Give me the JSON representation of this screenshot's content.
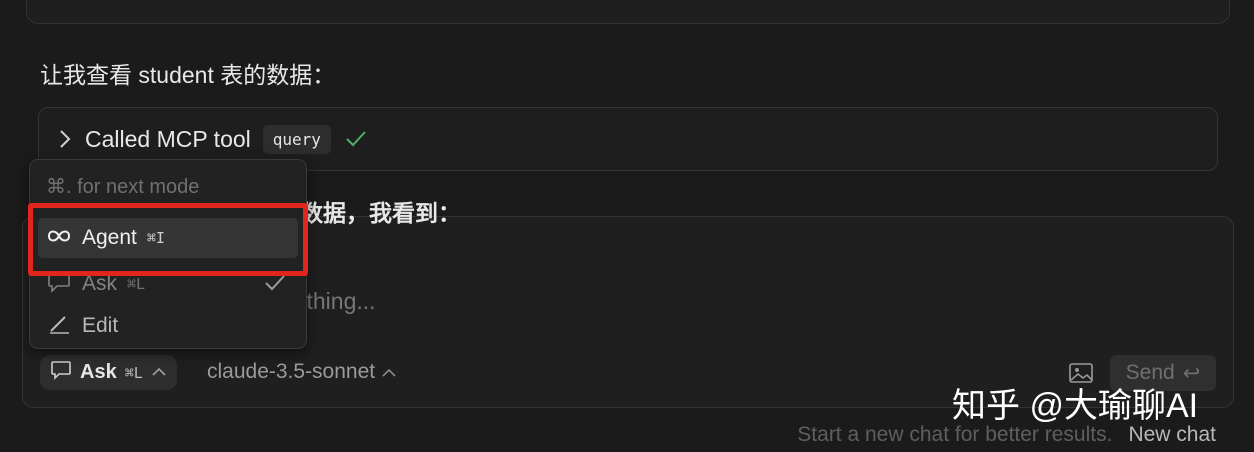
{
  "messages": {
    "intro_text": "让我查看 student 表的数据：",
    "tool_call": {
      "label": "Called MCP tool",
      "tool_name": "query",
      "status": "success"
    },
    "partial_text": "数据，我看到："
  },
  "composer": {
    "placeholder_partial": "ything...",
    "mode_button": {
      "label": "Ask",
      "shortcut": "⌘L"
    },
    "model": "claude-3.5-sonnet",
    "send_label": "Send",
    "send_shortcut": "↩"
  },
  "footer": {
    "hint": "Start a new chat for better results.",
    "new_chat": "New chat"
  },
  "mode_menu": {
    "hint": "⌘. for next mode",
    "items": [
      {
        "label": "Agent",
        "shortcut": "⌘I",
        "icon": "infinity-icon",
        "highlighted": true
      },
      {
        "label": "Ask",
        "shortcut": "⌘L",
        "icon": "chat-bubble-icon",
        "selected": true
      },
      {
        "label": "Edit",
        "shortcut": "",
        "icon": "pencil-icon"
      }
    ]
  },
  "watermark": "知乎 @大瑜聊AI",
  "colors": {
    "background": "#1b1b1b",
    "highlight": "#e0261d",
    "success_check": "#4caf6e"
  }
}
